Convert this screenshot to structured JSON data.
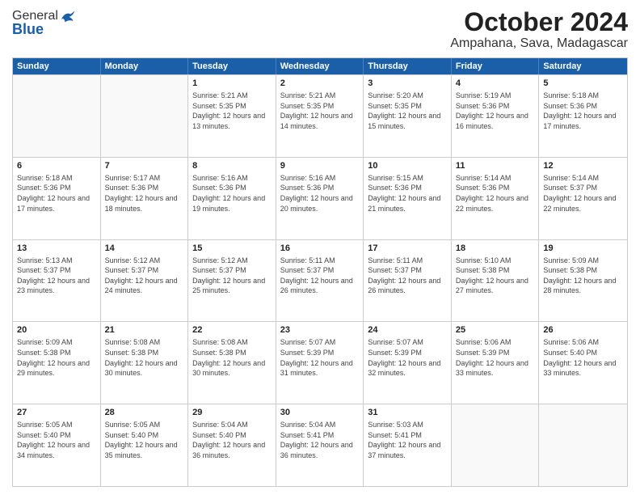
{
  "logo": {
    "line1": "General",
    "line2": "Blue"
  },
  "title": "October 2024",
  "location": "Ampahana, Sava, Madagascar",
  "weekdays": [
    "Sunday",
    "Monday",
    "Tuesday",
    "Wednesday",
    "Thursday",
    "Friday",
    "Saturday"
  ],
  "rows": [
    [
      {
        "day": "",
        "sunrise": "",
        "sunset": "",
        "daylight": ""
      },
      {
        "day": "",
        "sunrise": "",
        "sunset": "",
        "daylight": ""
      },
      {
        "day": "1",
        "sunrise": "Sunrise: 5:21 AM",
        "sunset": "Sunset: 5:35 PM",
        "daylight": "Daylight: 12 hours and 13 minutes."
      },
      {
        "day": "2",
        "sunrise": "Sunrise: 5:21 AM",
        "sunset": "Sunset: 5:35 PM",
        "daylight": "Daylight: 12 hours and 14 minutes."
      },
      {
        "day": "3",
        "sunrise": "Sunrise: 5:20 AM",
        "sunset": "Sunset: 5:35 PM",
        "daylight": "Daylight: 12 hours and 15 minutes."
      },
      {
        "day": "4",
        "sunrise": "Sunrise: 5:19 AM",
        "sunset": "Sunset: 5:36 PM",
        "daylight": "Daylight: 12 hours and 16 minutes."
      },
      {
        "day": "5",
        "sunrise": "Sunrise: 5:18 AM",
        "sunset": "Sunset: 5:36 PM",
        "daylight": "Daylight: 12 hours and 17 minutes."
      }
    ],
    [
      {
        "day": "6",
        "sunrise": "Sunrise: 5:18 AM",
        "sunset": "Sunset: 5:36 PM",
        "daylight": "Daylight: 12 hours and 17 minutes."
      },
      {
        "day": "7",
        "sunrise": "Sunrise: 5:17 AM",
        "sunset": "Sunset: 5:36 PM",
        "daylight": "Daylight: 12 hours and 18 minutes."
      },
      {
        "day": "8",
        "sunrise": "Sunrise: 5:16 AM",
        "sunset": "Sunset: 5:36 PM",
        "daylight": "Daylight: 12 hours and 19 minutes."
      },
      {
        "day": "9",
        "sunrise": "Sunrise: 5:16 AM",
        "sunset": "Sunset: 5:36 PM",
        "daylight": "Daylight: 12 hours and 20 minutes."
      },
      {
        "day": "10",
        "sunrise": "Sunrise: 5:15 AM",
        "sunset": "Sunset: 5:36 PM",
        "daylight": "Daylight: 12 hours and 21 minutes."
      },
      {
        "day": "11",
        "sunrise": "Sunrise: 5:14 AM",
        "sunset": "Sunset: 5:36 PM",
        "daylight": "Daylight: 12 hours and 22 minutes."
      },
      {
        "day": "12",
        "sunrise": "Sunrise: 5:14 AM",
        "sunset": "Sunset: 5:37 PM",
        "daylight": "Daylight: 12 hours and 22 minutes."
      }
    ],
    [
      {
        "day": "13",
        "sunrise": "Sunrise: 5:13 AM",
        "sunset": "Sunset: 5:37 PM",
        "daylight": "Daylight: 12 hours and 23 minutes."
      },
      {
        "day": "14",
        "sunrise": "Sunrise: 5:12 AM",
        "sunset": "Sunset: 5:37 PM",
        "daylight": "Daylight: 12 hours and 24 minutes."
      },
      {
        "day": "15",
        "sunrise": "Sunrise: 5:12 AM",
        "sunset": "Sunset: 5:37 PM",
        "daylight": "Daylight: 12 hours and 25 minutes."
      },
      {
        "day": "16",
        "sunrise": "Sunrise: 5:11 AM",
        "sunset": "Sunset: 5:37 PM",
        "daylight": "Daylight: 12 hours and 26 minutes."
      },
      {
        "day": "17",
        "sunrise": "Sunrise: 5:11 AM",
        "sunset": "Sunset: 5:37 PM",
        "daylight": "Daylight: 12 hours and 26 minutes."
      },
      {
        "day": "18",
        "sunrise": "Sunrise: 5:10 AM",
        "sunset": "Sunset: 5:38 PM",
        "daylight": "Daylight: 12 hours and 27 minutes."
      },
      {
        "day": "19",
        "sunrise": "Sunrise: 5:09 AM",
        "sunset": "Sunset: 5:38 PM",
        "daylight": "Daylight: 12 hours and 28 minutes."
      }
    ],
    [
      {
        "day": "20",
        "sunrise": "Sunrise: 5:09 AM",
        "sunset": "Sunset: 5:38 PM",
        "daylight": "Daylight: 12 hours and 29 minutes."
      },
      {
        "day": "21",
        "sunrise": "Sunrise: 5:08 AM",
        "sunset": "Sunset: 5:38 PM",
        "daylight": "Daylight: 12 hours and 30 minutes."
      },
      {
        "day": "22",
        "sunrise": "Sunrise: 5:08 AM",
        "sunset": "Sunset: 5:38 PM",
        "daylight": "Daylight: 12 hours and 30 minutes."
      },
      {
        "day": "23",
        "sunrise": "Sunrise: 5:07 AM",
        "sunset": "Sunset: 5:39 PM",
        "daylight": "Daylight: 12 hours and 31 minutes."
      },
      {
        "day": "24",
        "sunrise": "Sunrise: 5:07 AM",
        "sunset": "Sunset: 5:39 PM",
        "daylight": "Daylight: 12 hours and 32 minutes."
      },
      {
        "day": "25",
        "sunrise": "Sunrise: 5:06 AM",
        "sunset": "Sunset: 5:39 PM",
        "daylight": "Daylight: 12 hours and 33 minutes."
      },
      {
        "day": "26",
        "sunrise": "Sunrise: 5:06 AM",
        "sunset": "Sunset: 5:40 PM",
        "daylight": "Daylight: 12 hours and 33 minutes."
      }
    ],
    [
      {
        "day": "27",
        "sunrise": "Sunrise: 5:05 AM",
        "sunset": "Sunset: 5:40 PM",
        "daylight": "Daylight: 12 hours and 34 minutes."
      },
      {
        "day": "28",
        "sunrise": "Sunrise: 5:05 AM",
        "sunset": "Sunset: 5:40 PM",
        "daylight": "Daylight: 12 hours and 35 minutes."
      },
      {
        "day": "29",
        "sunrise": "Sunrise: 5:04 AM",
        "sunset": "Sunset: 5:40 PM",
        "daylight": "Daylight: 12 hours and 36 minutes."
      },
      {
        "day": "30",
        "sunrise": "Sunrise: 5:04 AM",
        "sunset": "Sunset: 5:41 PM",
        "daylight": "Daylight: 12 hours and 36 minutes."
      },
      {
        "day": "31",
        "sunrise": "Sunrise: 5:03 AM",
        "sunset": "Sunset: 5:41 PM",
        "daylight": "Daylight: 12 hours and 37 minutes."
      },
      {
        "day": "",
        "sunrise": "",
        "sunset": "",
        "daylight": ""
      },
      {
        "day": "",
        "sunrise": "",
        "sunset": "",
        "daylight": ""
      }
    ]
  ]
}
